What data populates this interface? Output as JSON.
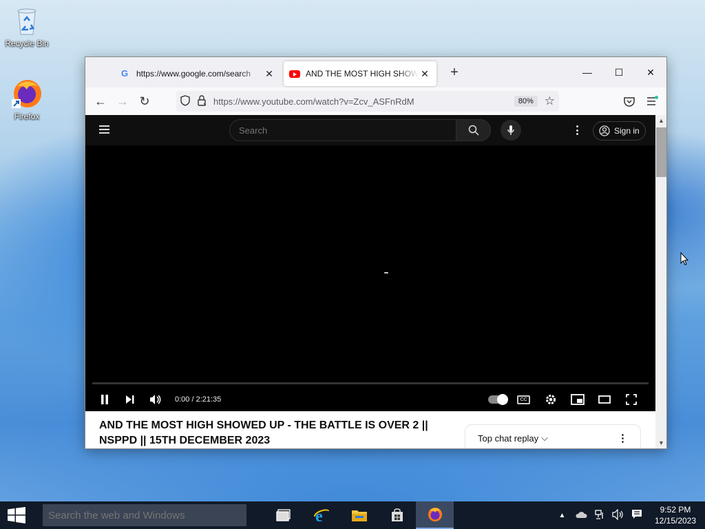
{
  "desktop": {
    "icons": [
      {
        "label": "Recycle Bin"
      },
      {
        "label": "Firefox"
      }
    ]
  },
  "browser": {
    "tabs": [
      {
        "title": "https://www.google.com/search",
        "favicon": "google-favicon",
        "active": false
      },
      {
        "title": "AND THE MOST HIGH SHOWED UP",
        "favicon": "youtube-favicon",
        "active": true
      }
    ],
    "new_tab_label": "+",
    "window_controls": {
      "minimize": "—",
      "maximize": "☐",
      "close": "✕"
    },
    "nav": {
      "back": "←",
      "forward": "→",
      "reload": "↻"
    },
    "url": "https://www.youtube.com/watch?v=Zcv_ASFnRdM",
    "zoom": "80%"
  },
  "youtube": {
    "search_placeholder": "Search",
    "sign_in": "Sign in",
    "player": {
      "time": "0:00 / 2:21:35",
      "progress_fraction": 0.0
    },
    "video_title": "AND THE MOST HIGH SHOWED UP - THE BATTLE IS OVER 2 || NSPPD || 15TH DECEMBER 2023",
    "chat": {
      "label": "Top chat replay",
      "chevron": "⌵"
    }
  },
  "taskbar": {
    "search_placeholder": "Search the web and Windows",
    "apps": [
      "task-view",
      "internet-explorer",
      "file-explorer",
      "store",
      "firefox"
    ],
    "clock_time": "9:52 PM",
    "clock_date": "12/15/2023"
  },
  "colors": {
    "youtube_red": "#ff0000",
    "taskbar_bg": "#101a28",
    "tab_active_bg": "#ffffff"
  }
}
